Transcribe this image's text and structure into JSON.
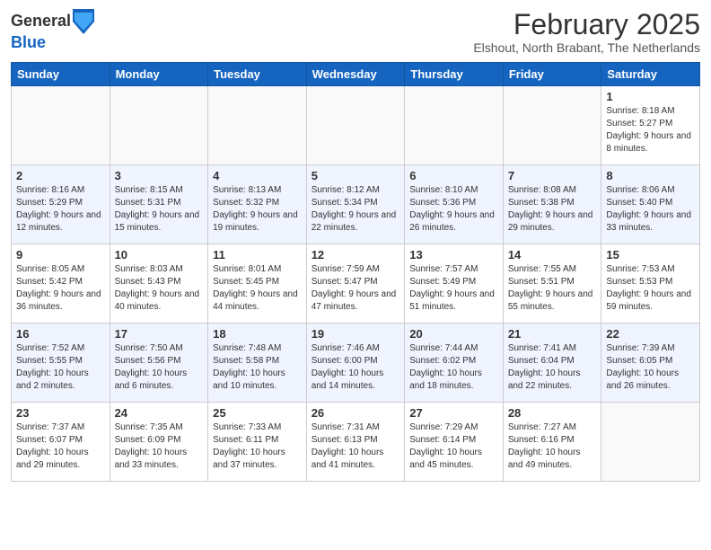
{
  "header": {
    "logo_general": "General",
    "logo_blue": "Blue",
    "month_year": "February 2025",
    "location": "Elshout, North Brabant, The Netherlands"
  },
  "days_of_week": [
    "Sunday",
    "Monday",
    "Tuesday",
    "Wednesday",
    "Thursday",
    "Friday",
    "Saturday"
  ],
  "weeks": [
    [
      {
        "num": "",
        "info": ""
      },
      {
        "num": "",
        "info": ""
      },
      {
        "num": "",
        "info": ""
      },
      {
        "num": "",
        "info": ""
      },
      {
        "num": "",
        "info": ""
      },
      {
        "num": "",
        "info": ""
      },
      {
        "num": "1",
        "info": "Sunrise: 8:18 AM\nSunset: 5:27 PM\nDaylight: 9 hours and 8 minutes."
      }
    ],
    [
      {
        "num": "2",
        "info": "Sunrise: 8:16 AM\nSunset: 5:29 PM\nDaylight: 9 hours and 12 minutes."
      },
      {
        "num": "3",
        "info": "Sunrise: 8:15 AM\nSunset: 5:31 PM\nDaylight: 9 hours and 15 minutes."
      },
      {
        "num": "4",
        "info": "Sunrise: 8:13 AM\nSunset: 5:32 PM\nDaylight: 9 hours and 19 minutes."
      },
      {
        "num": "5",
        "info": "Sunrise: 8:12 AM\nSunset: 5:34 PM\nDaylight: 9 hours and 22 minutes."
      },
      {
        "num": "6",
        "info": "Sunrise: 8:10 AM\nSunset: 5:36 PM\nDaylight: 9 hours and 26 minutes."
      },
      {
        "num": "7",
        "info": "Sunrise: 8:08 AM\nSunset: 5:38 PM\nDaylight: 9 hours and 29 minutes."
      },
      {
        "num": "8",
        "info": "Sunrise: 8:06 AM\nSunset: 5:40 PM\nDaylight: 9 hours and 33 minutes."
      }
    ],
    [
      {
        "num": "9",
        "info": "Sunrise: 8:05 AM\nSunset: 5:42 PM\nDaylight: 9 hours and 36 minutes."
      },
      {
        "num": "10",
        "info": "Sunrise: 8:03 AM\nSunset: 5:43 PM\nDaylight: 9 hours and 40 minutes."
      },
      {
        "num": "11",
        "info": "Sunrise: 8:01 AM\nSunset: 5:45 PM\nDaylight: 9 hours and 44 minutes."
      },
      {
        "num": "12",
        "info": "Sunrise: 7:59 AM\nSunset: 5:47 PM\nDaylight: 9 hours and 47 minutes."
      },
      {
        "num": "13",
        "info": "Sunrise: 7:57 AM\nSunset: 5:49 PM\nDaylight: 9 hours and 51 minutes."
      },
      {
        "num": "14",
        "info": "Sunrise: 7:55 AM\nSunset: 5:51 PM\nDaylight: 9 hours and 55 minutes."
      },
      {
        "num": "15",
        "info": "Sunrise: 7:53 AM\nSunset: 5:53 PM\nDaylight: 9 hours and 59 minutes."
      }
    ],
    [
      {
        "num": "16",
        "info": "Sunrise: 7:52 AM\nSunset: 5:55 PM\nDaylight: 10 hours and 2 minutes."
      },
      {
        "num": "17",
        "info": "Sunrise: 7:50 AM\nSunset: 5:56 PM\nDaylight: 10 hours and 6 minutes."
      },
      {
        "num": "18",
        "info": "Sunrise: 7:48 AM\nSunset: 5:58 PM\nDaylight: 10 hours and 10 minutes."
      },
      {
        "num": "19",
        "info": "Sunrise: 7:46 AM\nSunset: 6:00 PM\nDaylight: 10 hours and 14 minutes."
      },
      {
        "num": "20",
        "info": "Sunrise: 7:44 AM\nSunset: 6:02 PM\nDaylight: 10 hours and 18 minutes."
      },
      {
        "num": "21",
        "info": "Sunrise: 7:41 AM\nSunset: 6:04 PM\nDaylight: 10 hours and 22 minutes."
      },
      {
        "num": "22",
        "info": "Sunrise: 7:39 AM\nSunset: 6:05 PM\nDaylight: 10 hours and 26 minutes."
      }
    ],
    [
      {
        "num": "23",
        "info": "Sunrise: 7:37 AM\nSunset: 6:07 PM\nDaylight: 10 hours and 29 minutes."
      },
      {
        "num": "24",
        "info": "Sunrise: 7:35 AM\nSunset: 6:09 PM\nDaylight: 10 hours and 33 minutes."
      },
      {
        "num": "25",
        "info": "Sunrise: 7:33 AM\nSunset: 6:11 PM\nDaylight: 10 hours and 37 minutes."
      },
      {
        "num": "26",
        "info": "Sunrise: 7:31 AM\nSunset: 6:13 PM\nDaylight: 10 hours and 41 minutes."
      },
      {
        "num": "27",
        "info": "Sunrise: 7:29 AM\nSunset: 6:14 PM\nDaylight: 10 hours and 45 minutes."
      },
      {
        "num": "28",
        "info": "Sunrise: 7:27 AM\nSunset: 6:16 PM\nDaylight: 10 hours and 49 minutes."
      },
      {
        "num": "",
        "info": ""
      }
    ]
  ]
}
